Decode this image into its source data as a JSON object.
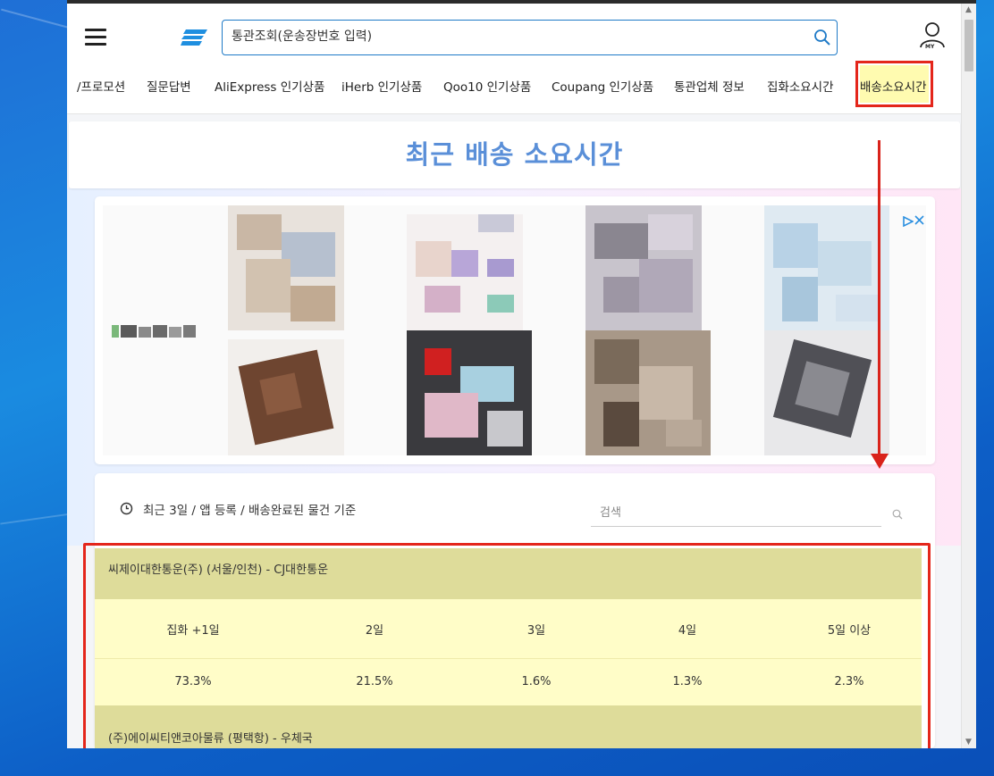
{
  "site": {
    "search_placeholder": "통관조회(운송장번호 입력)",
    "my_label": "MY"
  },
  "nav": {
    "items": [
      {
        "label": "/프로모션"
      },
      {
        "label": "질문답변"
      },
      {
        "label": "AliExpress 인기상품"
      },
      {
        "label": "iHerb 인기상품"
      },
      {
        "label": "Qoo10 인기상품"
      },
      {
        "label": "Coupang 인기상품"
      },
      {
        "label": "통관업체 정보"
      },
      {
        "label": "집화소요시간"
      },
      {
        "label": "배송소요시간"
      }
    ],
    "active": "배송소요시간"
  },
  "page": {
    "title": "최근 배송 소요시간"
  },
  "filter": {
    "info_text": "최근 3일 / 앱 등록 / 배송완료된 물건 기준",
    "search_placeholder": "검색"
  },
  "table": {
    "columns": [
      "집화 +1일",
      "2일",
      "3일",
      "4일",
      "5일 이상"
    ],
    "carriers": [
      {
        "name": "씨제이대한통운(주) (서울/인천) - CJ대한통운",
        "values": [
          "73.3%",
          "21.5%",
          "1.6%",
          "1.3%",
          "2.3%"
        ]
      },
      {
        "name": "(주)에이씨티앤코아물류 (평택항) - 우체국"
      }
    ]
  },
  "colors": {
    "accent": "#1f7ac7",
    "title": "#5a8fd8",
    "highlight": "#e4261b",
    "carrier_head_bg": "#dedc9a",
    "row_bg": "#fffdc8"
  }
}
